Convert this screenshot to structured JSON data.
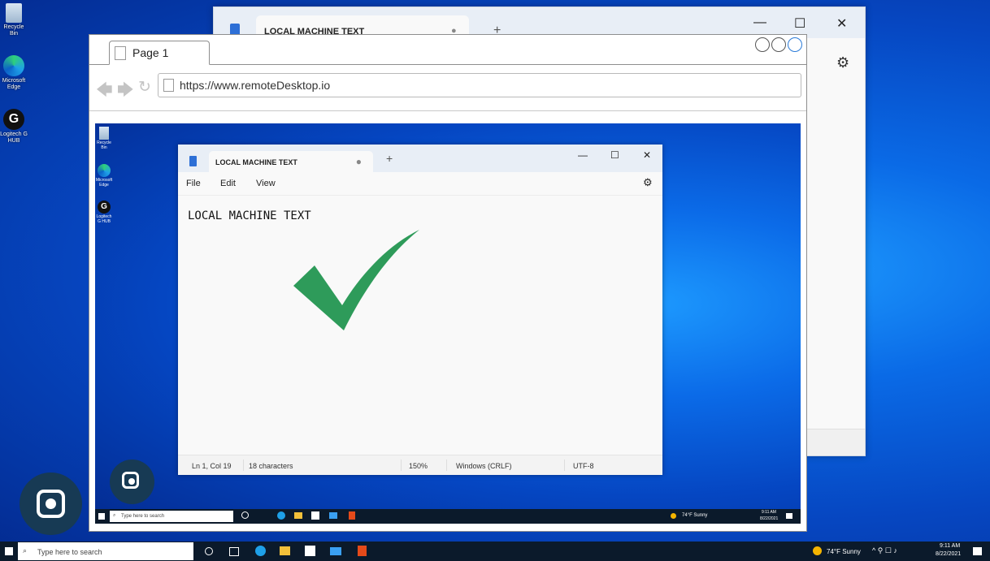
{
  "desktop": {
    "icons": [
      {
        "label": "Recycle Bin"
      },
      {
        "label": "Microsoft Edge"
      },
      {
        "label": "Logitech G HUB"
      }
    ]
  },
  "background_window": {
    "tab_title": "LOCAL MACHINE TEXT",
    "tab_dot": "●",
    "new_tab": "+",
    "minimize": "—",
    "maximize": "☐",
    "close": "✕"
  },
  "browser": {
    "tab_title": "Page 1",
    "url": "https://www.remoteDesktop.io"
  },
  "remote_desktop": {
    "icons": [
      {
        "label": "Recycle Bin"
      },
      {
        "label": "Microsoft Edge"
      },
      {
        "label": "Logitech G HUB"
      }
    ],
    "notepad": {
      "tab_title": "LOCAL MACHINE TEXT",
      "tab_dot": "●",
      "new_tab": "+",
      "minimize": "—",
      "maximize": "☐",
      "close": "✕",
      "menu": {
        "file": "File",
        "edit": "Edit",
        "view": "View"
      },
      "content": "LOCAL MACHINE TEXT",
      "status": {
        "position": "Ln 1, Col 19",
        "characters": "18 characters",
        "zoom": "150%",
        "line_ending": "Windows (CRLF)",
        "encoding": "UTF-8"
      }
    },
    "taskbar": {
      "search_placeholder": "Type here to search",
      "weather": "74°F  Sunny",
      "time": "9:11 AM",
      "date": "8/22/2021"
    }
  },
  "taskbar": {
    "search_placeholder": "Type here to search",
    "weather": "74°F  Sunny",
    "time": "9:11 AM",
    "date": "8/22/2021"
  },
  "colors": {
    "checkmark": "#2e9b5a",
    "lens_button": "#173a54",
    "taskbar": "#0b1a2b"
  }
}
